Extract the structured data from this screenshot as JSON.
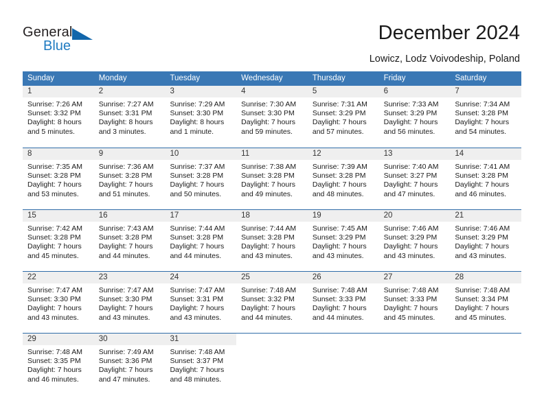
{
  "brand": {
    "name_part1": "General",
    "name_part2": "Blue",
    "logo_icon": "triangle-icon",
    "accent_color": "#1266ab",
    "text_color": "#231f20"
  },
  "header": {
    "title": "December 2024",
    "subtitle": "Lowicz, Lodz Voivodeship, Poland"
  },
  "calendar": {
    "header_bg_color": "#3a78b5",
    "row_divider_color": "#2f6ca8",
    "date_band_color": "#efefef",
    "weekdays": [
      "Sunday",
      "Monday",
      "Tuesday",
      "Wednesday",
      "Thursday",
      "Friday",
      "Saturday"
    ],
    "weeks": [
      [
        {
          "day": "1",
          "sunrise": "Sunrise: 7:26 AM",
          "sunset": "Sunset: 3:32 PM",
          "daylight_line1": "Daylight: 8 hours",
          "daylight_line2": "and 5 minutes."
        },
        {
          "day": "2",
          "sunrise": "Sunrise: 7:27 AM",
          "sunset": "Sunset: 3:31 PM",
          "daylight_line1": "Daylight: 8 hours",
          "daylight_line2": "and 3 minutes."
        },
        {
          "day": "3",
          "sunrise": "Sunrise: 7:29 AM",
          "sunset": "Sunset: 3:30 PM",
          "daylight_line1": "Daylight: 8 hours",
          "daylight_line2": "and 1 minute."
        },
        {
          "day": "4",
          "sunrise": "Sunrise: 7:30 AM",
          "sunset": "Sunset: 3:30 PM",
          "daylight_line1": "Daylight: 7 hours",
          "daylight_line2": "and 59 minutes."
        },
        {
          "day": "5",
          "sunrise": "Sunrise: 7:31 AM",
          "sunset": "Sunset: 3:29 PM",
          "daylight_line1": "Daylight: 7 hours",
          "daylight_line2": "and 57 minutes."
        },
        {
          "day": "6",
          "sunrise": "Sunrise: 7:33 AM",
          "sunset": "Sunset: 3:29 PM",
          "daylight_line1": "Daylight: 7 hours",
          "daylight_line2": "and 56 minutes."
        },
        {
          "day": "7",
          "sunrise": "Sunrise: 7:34 AM",
          "sunset": "Sunset: 3:28 PM",
          "daylight_line1": "Daylight: 7 hours",
          "daylight_line2": "and 54 minutes."
        }
      ],
      [
        {
          "day": "8",
          "sunrise": "Sunrise: 7:35 AM",
          "sunset": "Sunset: 3:28 PM",
          "daylight_line1": "Daylight: 7 hours",
          "daylight_line2": "and 53 minutes."
        },
        {
          "day": "9",
          "sunrise": "Sunrise: 7:36 AM",
          "sunset": "Sunset: 3:28 PM",
          "daylight_line1": "Daylight: 7 hours",
          "daylight_line2": "and 51 minutes."
        },
        {
          "day": "10",
          "sunrise": "Sunrise: 7:37 AM",
          "sunset": "Sunset: 3:28 PM",
          "daylight_line1": "Daylight: 7 hours",
          "daylight_line2": "and 50 minutes."
        },
        {
          "day": "11",
          "sunrise": "Sunrise: 7:38 AM",
          "sunset": "Sunset: 3:28 PM",
          "daylight_line1": "Daylight: 7 hours",
          "daylight_line2": "and 49 minutes."
        },
        {
          "day": "12",
          "sunrise": "Sunrise: 7:39 AM",
          "sunset": "Sunset: 3:28 PM",
          "daylight_line1": "Daylight: 7 hours",
          "daylight_line2": "and 48 minutes."
        },
        {
          "day": "13",
          "sunrise": "Sunrise: 7:40 AM",
          "sunset": "Sunset: 3:27 PM",
          "daylight_line1": "Daylight: 7 hours",
          "daylight_line2": "and 47 minutes."
        },
        {
          "day": "14",
          "sunrise": "Sunrise: 7:41 AM",
          "sunset": "Sunset: 3:28 PM",
          "daylight_line1": "Daylight: 7 hours",
          "daylight_line2": "and 46 minutes."
        }
      ],
      [
        {
          "day": "15",
          "sunrise": "Sunrise: 7:42 AM",
          "sunset": "Sunset: 3:28 PM",
          "daylight_line1": "Daylight: 7 hours",
          "daylight_line2": "and 45 minutes."
        },
        {
          "day": "16",
          "sunrise": "Sunrise: 7:43 AM",
          "sunset": "Sunset: 3:28 PM",
          "daylight_line1": "Daylight: 7 hours",
          "daylight_line2": "and 44 minutes."
        },
        {
          "day": "17",
          "sunrise": "Sunrise: 7:44 AM",
          "sunset": "Sunset: 3:28 PM",
          "daylight_line1": "Daylight: 7 hours",
          "daylight_line2": "and 44 minutes."
        },
        {
          "day": "18",
          "sunrise": "Sunrise: 7:44 AM",
          "sunset": "Sunset: 3:28 PM",
          "daylight_line1": "Daylight: 7 hours",
          "daylight_line2": "and 43 minutes."
        },
        {
          "day": "19",
          "sunrise": "Sunrise: 7:45 AM",
          "sunset": "Sunset: 3:29 PM",
          "daylight_line1": "Daylight: 7 hours",
          "daylight_line2": "and 43 minutes."
        },
        {
          "day": "20",
          "sunrise": "Sunrise: 7:46 AM",
          "sunset": "Sunset: 3:29 PM",
          "daylight_line1": "Daylight: 7 hours",
          "daylight_line2": "and 43 minutes."
        },
        {
          "day": "21",
          "sunrise": "Sunrise: 7:46 AM",
          "sunset": "Sunset: 3:29 PM",
          "daylight_line1": "Daylight: 7 hours",
          "daylight_line2": "and 43 minutes."
        }
      ],
      [
        {
          "day": "22",
          "sunrise": "Sunrise: 7:47 AM",
          "sunset": "Sunset: 3:30 PM",
          "daylight_line1": "Daylight: 7 hours",
          "daylight_line2": "and 43 minutes."
        },
        {
          "day": "23",
          "sunrise": "Sunrise: 7:47 AM",
          "sunset": "Sunset: 3:30 PM",
          "daylight_line1": "Daylight: 7 hours",
          "daylight_line2": "and 43 minutes."
        },
        {
          "day": "24",
          "sunrise": "Sunrise: 7:47 AM",
          "sunset": "Sunset: 3:31 PM",
          "daylight_line1": "Daylight: 7 hours",
          "daylight_line2": "and 43 minutes."
        },
        {
          "day": "25",
          "sunrise": "Sunrise: 7:48 AM",
          "sunset": "Sunset: 3:32 PM",
          "daylight_line1": "Daylight: 7 hours",
          "daylight_line2": "and 44 minutes."
        },
        {
          "day": "26",
          "sunrise": "Sunrise: 7:48 AM",
          "sunset": "Sunset: 3:33 PM",
          "daylight_line1": "Daylight: 7 hours",
          "daylight_line2": "and 44 minutes."
        },
        {
          "day": "27",
          "sunrise": "Sunrise: 7:48 AM",
          "sunset": "Sunset: 3:33 PM",
          "daylight_line1": "Daylight: 7 hours",
          "daylight_line2": "and 45 minutes."
        },
        {
          "day": "28",
          "sunrise": "Sunrise: 7:48 AM",
          "sunset": "Sunset: 3:34 PM",
          "daylight_line1": "Daylight: 7 hours",
          "daylight_line2": "and 45 minutes."
        }
      ],
      [
        {
          "day": "29",
          "sunrise": "Sunrise: 7:48 AM",
          "sunset": "Sunset: 3:35 PM",
          "daylight_line1": "Daylight: 7 hours",
          "daylight_line2": "and 46 minutes."
        },
        {
          "day": "30",
          "sunrise": "Sunrise: 7:49 AM",
          "sunset": "Sunset: 3:36 PM",
          "daylight_line1": "Daylight: 7 hours",
          "daylight_line2": "and 47 minutes."
        },
        {
          "day": "31",
          "sunrise": "Sunrise: 7:48 AM",
          "sunset": "Sunset: 3:37 PM",
          "daylight_line1": "Daylight: 7 hours",
          "daylight_line2": "and 48 minutes."
        },
        {
          "day": "",
          "sunrise": "",
          "sunset": "",
          "daylight_line1": "",
          "daylight_line2": ""
        },
        {
          "day": "",
          "sunrise": "",
          "sunset": "",
          "daylight_line1": "",
          "daylight_line2": ""
        },
        {
          "day": "",
          "sunrise": "",
          "sunset": "",
          "daylight_line1": "",
          "daylight_line2": ""
        },
        {
          "day": "",
          "sunrise": "",
          "sunset": "",
          "daylight_line1": "",
          "daylight_line2": ""
        }
      ]
    ]
  }
}
